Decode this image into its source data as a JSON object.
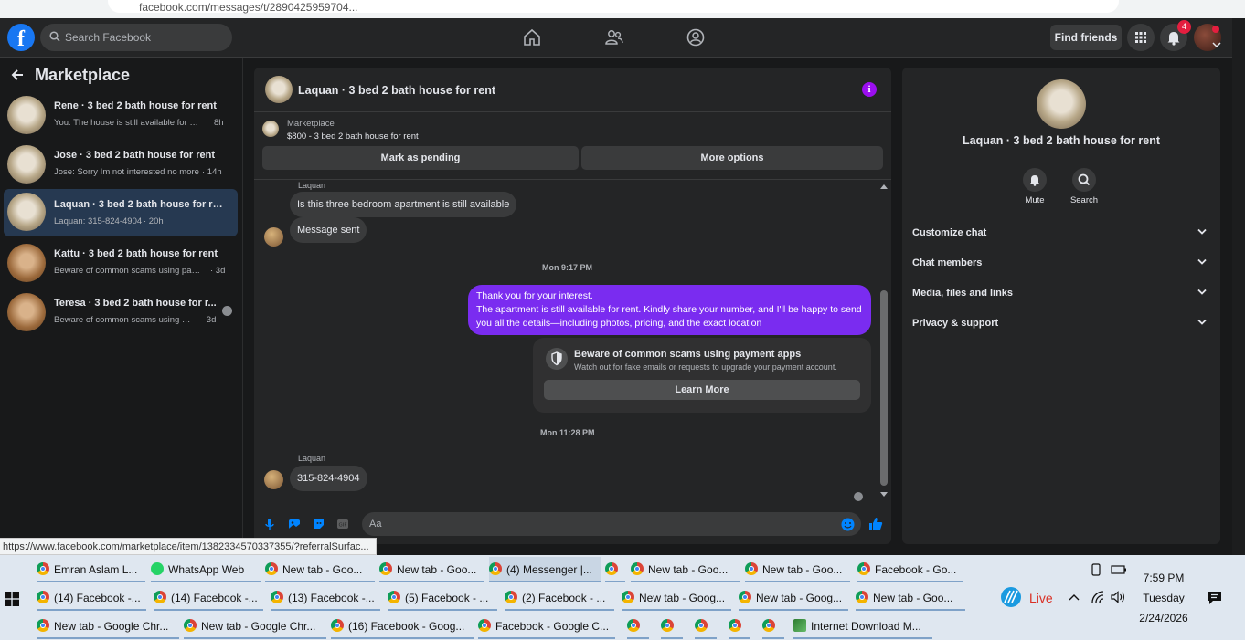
{
  "browser": {
    "url_fragment": "facebook.com/messages/t/2890425959704..."
  },
  "topbar": {
    "logo": "f",
    "search_placeholder": "Search Facebook",
    "find_friends": "Find friends",
    "notification_count": "4"
  },
  "sidebar": {
    "title": "Marketplace",
    "conversations": [
      {
        "name": "Rene · 3 bed 2 bath house for rent",
        "snippet": "You: The house is still available for ren...",
        "time": "8h"
      },
      {
        "name": "Jose · 3 bed 2 bath house for rent",
        "snippet": "Jose: Sorry Im not interested no more",
        "time": "· 14h"
      },
      {
        "name": "Laquan · 3 bed 2 bath house for rent",
        "snippet": "Laquan: 315-824-4904",
        "time": "· 20h"
      },
      {
        "name": "Kattu · 3 bed 2 bath house for rent",
        "snippet": "Beware of common scams using pay...",
        "time": "· 3d"
      },
      {
        "name": "Teresa · 3 bed 2 bath house for r...",
        "snippet": "Beware of common scams using p...",
        "time": "· 3d"
      }
    ]
  },
  "chat": {
    "title": "Laquan · 3 bed 2 bath house for rent",
    "listing_label": "Marketplace",
    "listing_price": "$800 - 3 bed 2 bath house for rent",
    "mark_pending": "Mark as pending",
    "more_options": "More options",
    "messages": {
      "sender1": "Laquan",
      "m1": "Is this three bedroom apartment is still available",
      "m2": "Message sent",
      "stamp1": "Mon 9:17 PM",
      "out_line1": "Thank you for your interest.",
      "out_line2": "The apartment is still available for rent. Kindly share your number, and I'll be happy to send you all the details—including photos, pricing, and the exact location",
      "scam_title": "Beware of common scams using payment apps",
      "scam_sub": "Watch out for fake emails or requests to upgrade your payment account.",
      "learn_more": "Learn More",
      "stamp2": "Mon 11:28 PM",
      "sender2": "Laquan",
      "m3": "315-824-4904"
    },
    "composer_placeholder": "Aa"
  },
  "details": {
    "title": "Laquan · 3 bed 2 bath house for rent",
    "mute": "Mute",
    "search": "Search",
    "sections": [
      "Customize chat",
      "Chat members",
      "Media, files and links",
      "Privacy & support"
    ]
  },
  "status_url": "https://www.facebook.com/marketplace/item/1382334570337355/?referralSurfac...",
  "taskbar": {
    "row1": [
      "Emran Aslam L...",
      "WhatsApp Web",
      "New tab - Goo...",
      "New tab - Goo...",
      "(4) Messenger |...",
      "New tab - Goo...",
      "New tab - Goo...",
      "Facebook - Go..."
    ],
    "row2": [
      "(14) Facebook -...",
      "(14) Facebook -...",
      "(13) Facebook -...",
      "(5) Facebook - ...",
      "(2) Facebook - ...",
      "New tab - Goog...",
      "New tab - Goog...",
      "New tab - Goo..."
    ],
    "row3": [
      "New tab - Google Chr...",
      "New tab - Google Chr...",
      "(16) Facebook - Goog...",
      "Facebook - Google C...",
      "Internet Download M..."
    ],
    "live": "Live",
    "time": "7:59 PM",
    "day": "Tuesday",
    "date": "2/24/2026"
  },
  "colors": {
    "accent": "#7a2cf0",
    "fb_blue": "#1877f2",
    "like_blue": "#0084ff"
  }
}
